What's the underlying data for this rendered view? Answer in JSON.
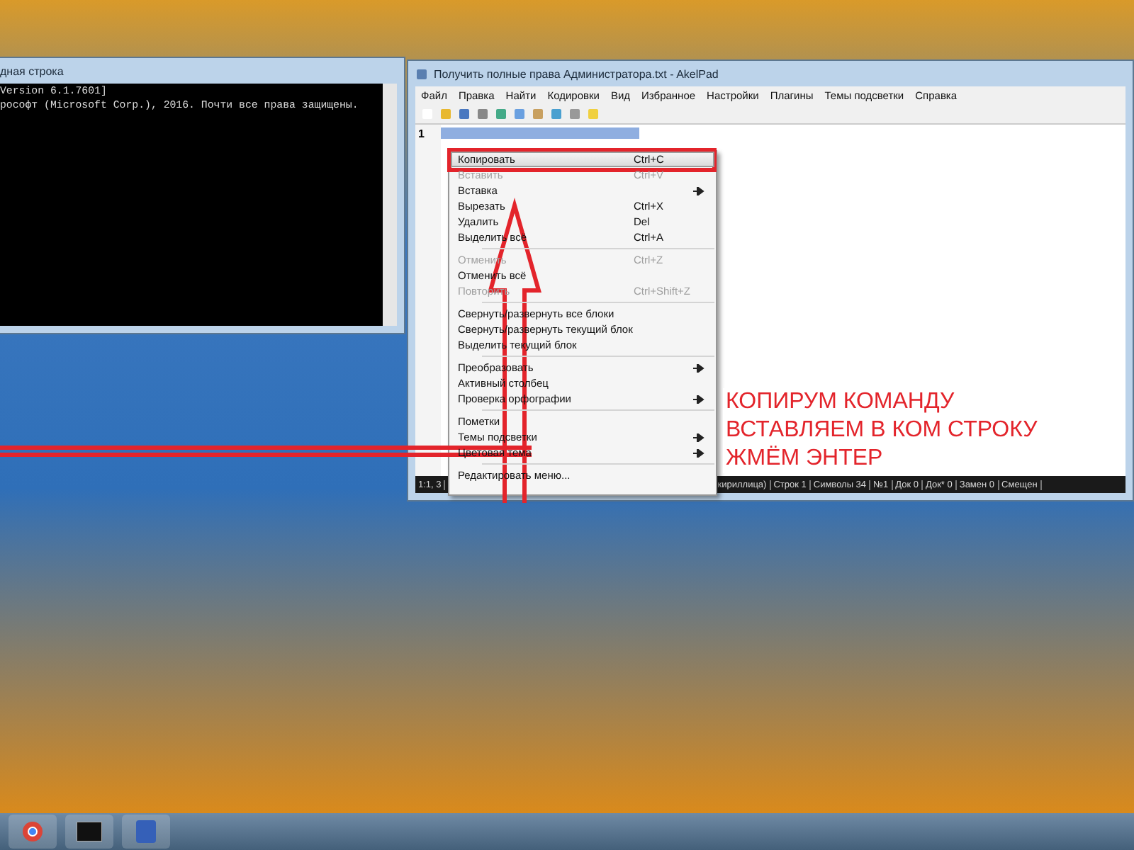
{
  "console_window": {
    "title": "дная строка",
    "lines": [
      "Version 6.1.7601]",
      "рософт (Microsoft Corp.), 2016. Почти все права защищены."
    ]
  },
  "editor_window": {
    "title": "Получить полные права Администратора.txt - AkelPad",
    "menu": [
      "Файл",
      "Правка",
      "Найти",
      "Кодировки",
      "Вид",
      "Избранное",
      "Настройки",
      "Плагины",
      "Темы подсветки",
      "Справка"
    ],
    "line_number": "1",
    "status_bar": [
      "1:1, 3",
      "кириллица)",
      "Строк 1",
      "Символы 34",
      "№1",
      "Док 0",
      "Док* 0",
      "Замен 0",
      "Смещен"
    ]
  },
  "context_menu": [
    {
      "kind": "item",
      "label": "Копировать",
      "shortcut": "Ctrl+C",
      "selected": true,
      "disabled": false,
      "submenu": false
    },
    {
      "kind": "item",
      "label": "Вставить",
      "shortcut": "Ctrl+V",
      "selected": false,
      "disabled": true,
      "submenu": false
    },
    {
      "kind": "item",
      "label": "Вставка",
      "selected": false,
      "disabled": false,
      "submenu": true
    },
    {
      "kind": "item",
      "label": "Вырезать",
      "shortcut": "Ctrl+X",
      "selected": false,
      "disabled": false,
      "submenu": false
    },
    {
      "kind": "item",
      "label": "Удалить",
      "shortcut": "Del",
      "selected": false,
      "disabled": false,
      "submenu": false
    },
    {
      "kind": "item",
      "label": "Выделить всё",
      "shortcut": "Ctrl+A",
      "selected": false,
      "disabled": false,
      "submenu": false
    },
    {
      "kind": "separator"
    },
    {
      "kind": "item",
      "label": "Отменить",
      "shortcut": "Ctrl+Z",
      "selected": false,
      "disabled": true,
      "submenu": false
    },
    {
      "kind": "item",
      "label": "Отменить всё",
      "selected": false,
      "disabled": false,
      "submenu": false
    },
    {
      "kind": "item",
      "label": "Повторить",
      "shortcut": "Ctrl+Shift+Z",
      "selected": false,
      "disabled": true,
      "submenu": false
    },
    {
      "kind": "separator"
    },
    {
      "kind": "item",
      "label": "Свернуть/развернуть все блоки",
      "selected": false,
      "disabled": false,
      "submenu": false
    },
    {
      "kind": "item",
      "label": "Свернуть/развернуть текущий блок",
      "selected": false,
      "disabled": false,
      "submenu": false
    },
    {
      "kind": "item",
      "label": "Выделить текущий блок",
      "selected": false,
      "disabled": false,
      "submenu": false
    },
    {
      "kind": "separator"
    },
    {
      "kind": "item",
      "label": "Преобразовать",
      "selected": false,
      "disabled": false,
      "submenu": true
    },
    {
      "kind": "item",
      "label": "Активный столбец",
      "selected": false,
      "disabled": false,
      "submenu": false
    },
    {
      "kind": "item",
      "label": "Проверка орфографии",
      "selected": false,
      "disabled": false,
      "submenu": true
    },
    {
      "kind": "separator"
    },
    {
      "kind": "item",
      "label": "Пометки",
      "selected": false,
      "disabled": false,
      "submenu": false
    },
    {
      "kind": "item",
      "label": "Темы подсветки",
      "selected": false,
      "disabled": false,
      "submenu": true
    },
    {
      "kind": "item",
      "label": "Цветовая тема",
      "selected": false,
      "disabled": false,
      "submenu": true
    },
    {
      "kind": "separator"
    },
    {
      "kind": "item",
      "label": "Редактировать меню...",
      "selected": false,
      "disabled": false,
      "submenu": false
    }
  ],
  "annotation": [
    "КОПИРУМ КОМАНДУ",
    "ВСТАВЛЯЕМ В КОМ СТРОКУ",
    "ЖМЁМ ЭНТЕР"
  ]
}
